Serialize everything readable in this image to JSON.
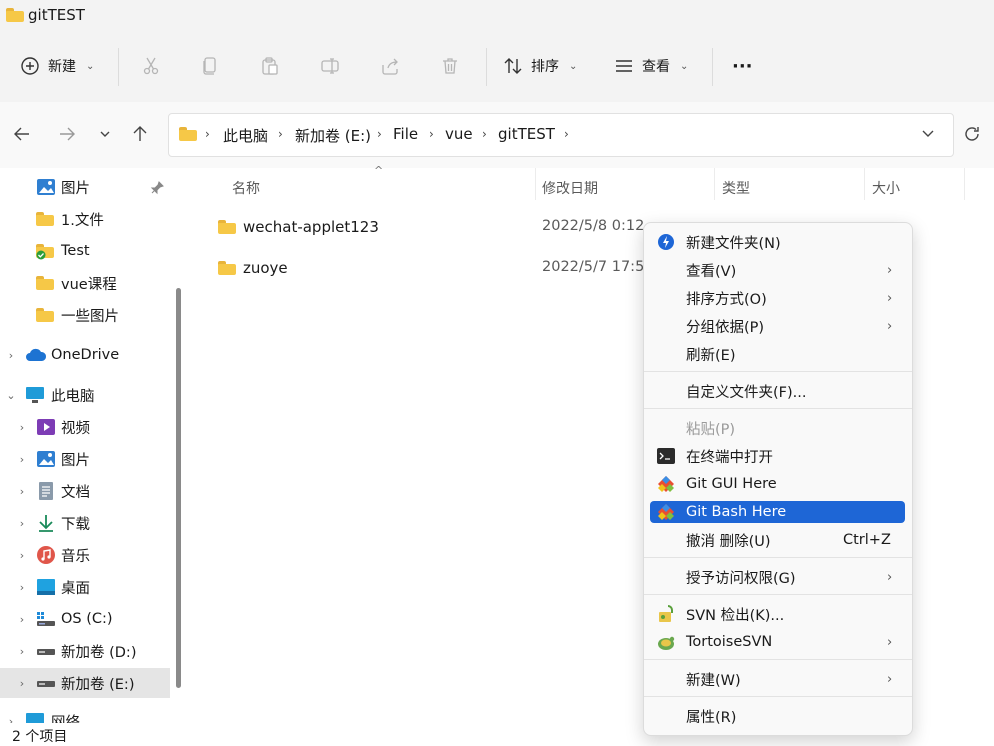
{
  "window": {
    "title": "gitTEST"
  },
  "toolbar": {
    "new_label": "新建",
    "sort_label": "排序",
    "view_label": "查看",
    "more_label": "···"
  },
  "address": {
    "crumbs": [
      "此电脑",
      "新加卷 (E:)",
      "File",
      "vue",
      "gitTEST"
    ]
  },
  "sidebar": {
    "items": [
      {
        "label": "图片",
        "icon": "pictures-icon"
      },
      {
        "label": "1.文件",
        "icon": "folder-icon"
      },
      {
        "label": "Test",
        "icon": "folder-check-icon"
      },
      {
        "label": "vue课程",
        "icon": "folder-icon"
      },
      {
        "label": "一些图片",
        "icon": "folder-icon"
      },
      {
        "label": "OneDrive",
        "icon": "onedrive-icon"
      },
      {
        "label": "此电脑",
        "icon": "pc-icon"
      },
      {
        "label": "视频",
        "icon": "video-icon"
      },
      {
        "label": "图片",
        "icon": "pictures-icon"
      },
      {
        "label": "文档",
        "icon": "documents-icon"
      },
      {
        "label": "下载",
        "icon": "download-icon"
      },
      {
        "label": "音乐",
        "icon": "music-icon"
      },
      {
        "label": "桌面",
        "icon": "desktop-icon"
      },
      {
        "label": "OS (C:)",
        "icon": "drive-os-icon"
      },
      {
        "label": "新加卷 (D:)",
        "icon": "drive-icon"
      },
      {
        "label": "新加卷 (E:)",
        "icon": "drive-icon"
      },
      {
        "label": "网络",
        "icon": "network-icon"
      }
    ]
  },
  "list": {
    "headers": {
      "name": "名称",
      "modified": "修改日期",
      "type": "类型",
      "size": "大小"
    },
    "rows": [
      {
        "name": "wechat-applet123",
        "modified": "2022/5/8 0:12"
      },
      {
        "name": "zuoye",
        "modified": "2022/5/7 17:5"
      }
    ]
  },
  "status": {
    "count_text": "2 个项目"
  },
  "context_menu": {
    "items": [
      {
        "label": "新建文件夹(N)"
      },
      {
        "label": "查看(V)"
      },
      {
        "label": "排序方式(O)"
      },
      {
        "label": "分组依据(P)"
      },
      {
        "label": "刷新(E)"
      },
      {
        "label": "自定义文件夹(F)..."
      },
      {
        "label": "粘贴(P)"
      },
      {
        "label": "在终端中打开"
      },
      {
        "label": "Git GUI Here"
      },
      {
        "label": "Git Bash Here"
      },
      {
        "label": "撤消 删除(U)",
        "shortcut": "Ctrl+Z"
      },
      {
        "label": "授予访问权限(G)"
      },
      {
        "label": "SVN 检出(K)..."
      },
      {
        "label": "TortoiseSVN"
      },
      {
        "label": "新建(W)"
      },
      {
        "label": "属性(R)"
      }
    ]
  },
  "colors": {
    "accent": "#1e66d6",
    "folder": "#f6c847"
  }
}
